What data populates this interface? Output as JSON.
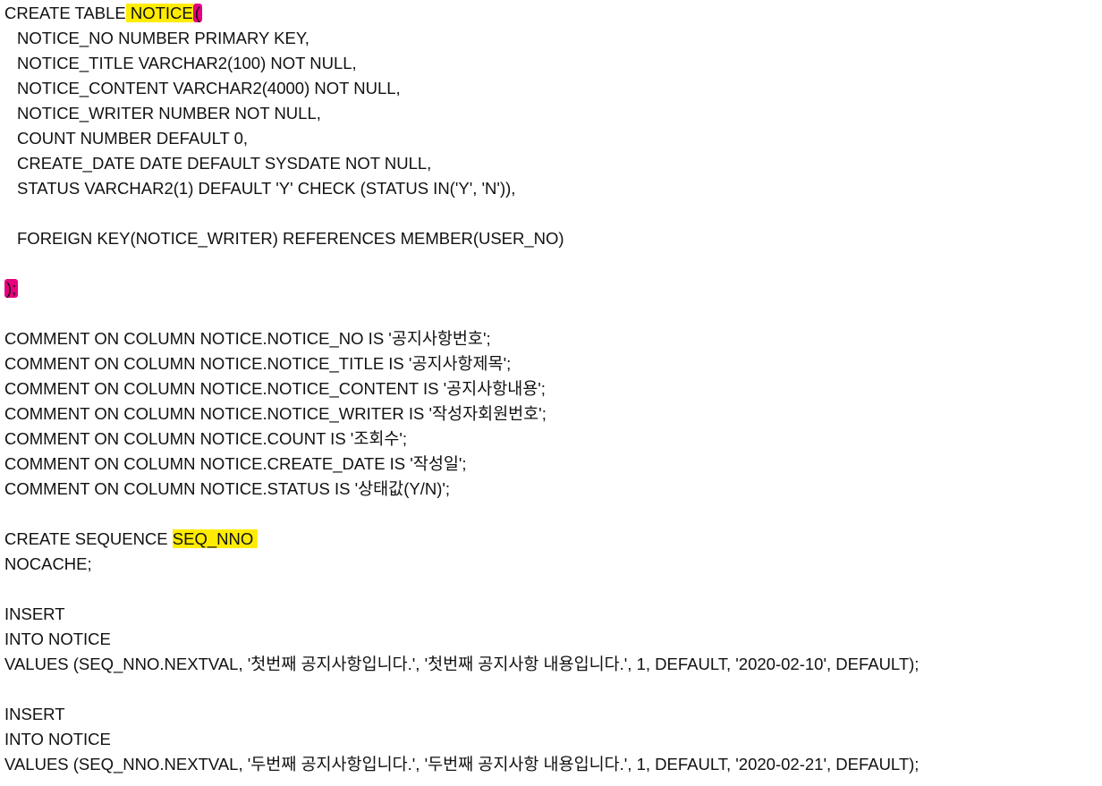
{
  "create_table": {
    "prefix": "CREATE TABLE",
    "name": " NOTICE",
    "open_paren": "(",
    "columns": [
      "NOTICE_NO NUMBER PRIMARY KEY,",
      "NOTICE_TITLE VARCHAR2(100) NOT NULL,",
      "NOTICE_CONTENT VARCHAR2(4000) NOT NULL,",
      "NOTICE_WRITER NUMBER NOT NULL,",
      "COUNT NUMBER DEFAULT 0,",
      "CREATE_DATE DATE DEFAULT SYSDATE NOT NULL,",
      "STATUS VARCHAR2(1) DEFAULT 'Y' CHECK (STATUS IN('Y', 'N')),"
    ],
    "foreign_key": "FOREIGN KEY(NOTICE_WRITER) REFERENCES MEMBER(USER_NO)",
    "close": ");"
  },
  "comments": [
    "COMMENT ON COLUMN NOTICE.NOTICE_NO IS '공지사항번호';",
    "COMMENT ON COLUMN NOTICE.NOTICE_TITLE IS '공지사항제목';",
    "COMMENT ON COLUMN NOTICE.NOTICE_CONTENT IS '공지사항내용';",
    "COMMENT ON COLUMN NOTICE.NOTICE_WRITER IS '작성자회원번호';",
    "COMMENT ON COLUMN NOTICE.COUNT IS '조회수';",
    "COMMENT ON COLUMN NOTICE.CREATE_DATE IS '작성일';",
    "COMMENT ON COLUMN NOTICE.STATUS IS '상태값(Y/N)';"
  ],
  "sequence": {
    "prefix": "CREATE SEQUENCE ",
    "name": "SEQ_NNO ",
    "option": "NOCACHE;"
  },
  "inserts": [
    {
      "line1": "INSERT",
      "line2": "INTO NOTICE",
      "line3": "VALUES (SEQ_NNO.NEXTVAL, '첫번째 공지사항입니다.', '첫번째 공지사항 내용입니다.', 1, DEFAULT, '2020-02-10', DEFAULT);"
    },
    {
      "line1": "INSERT",
      "line2": "INTO NOTICE",
      "line3": "VALUES (SEQ_NNO.NEXTVAL, '두번째 공지사항입니다.', '두번째 공지사항 내용입니다.', 1, DEFAULT, '2020-02-21', DEFAULT);"
    }
  ],
  "colors": {
    "highlight_yellow": "#ffec00",
    "highlight_pink": "#e6007e"
  }
}
